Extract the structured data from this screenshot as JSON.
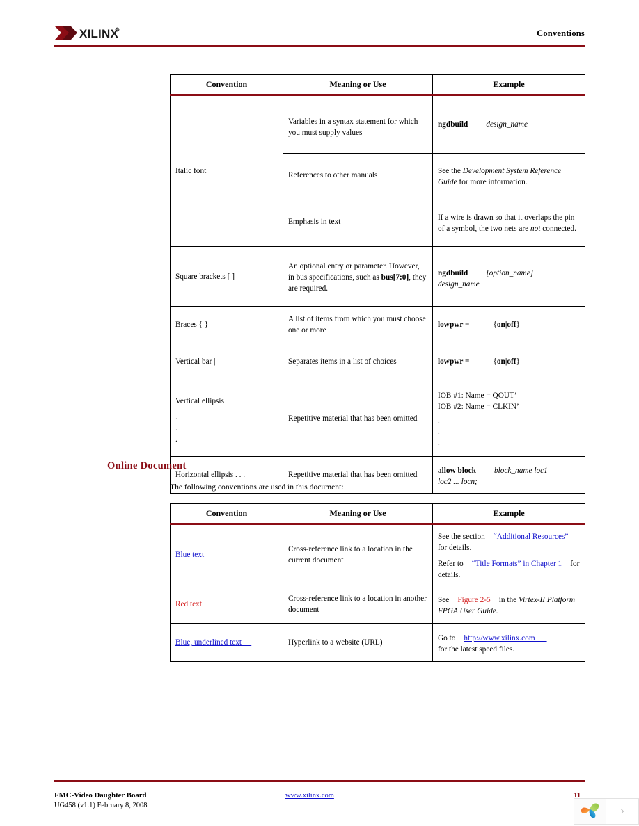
{
  "header": {
    "logo_name": "xilinx-logo",
    "logo_text": "XILINX",
    "title": "Conventions",
    "rule_color": "#8B0D15"
  },
  "table1": {
    "name": "typographical-conventions-table",
    "columns": [
      "Convention",
      "Meaning or Use",
      "Example"
    ],
    "rows": [
      {
        "convention": "Italic font",
        "sub": [
          {
            "meaning": "Variables in a syntax statement for which you must supply values",
            "example_bold": "ngdbuild",
            "example_italic": "design_name"
          },
          {
            "meaning": "References to other manuals",
            "example": "See the Development System Reference Guide for more information."
          },
          {
            "meaning": "Emphasis in text",
            "example": "If a wire is drawn so that it overlaps the pin of a symbol, the two nets are not connected."
          }
        ]
      },
      {
        "convention": "Square brackets   [ ]",
        "meaning": "An optional entry or parameter. However, in bus specifications, such as bus[7:0], they are required.",
        "example_bold": "ngdbuild",
        "example_italic1": "[option_name]",
        "example_italic2": "design_name"
      },
      {
        "convention": "Braces   { }",
        "meaning": "A list of items from which you must choose one or more",
        "example_bold": "lowpwr =",
        "example_braces": "{on|off}"
      },
      {
        "convention": "Vertical bar   |",
        "meaning": "Separates items in a list of choices",
        "example_bold": "lowpwr =",
        "example_braces": "{on|off}"
      },
      {
        "convention": "Vertical ellipsis",
        "convention_dots": [
          ".",
          ".",
          "."
        ],
        "meaning": "Repetitive material that has been omitted",
        "example_line1": "IOB #1: Name = QOUT’",
        "example_line2": "IOB #2: Name = CLKIN’",
        "example_dots": [
          ".",
          ".",
          "."
        ]
      },
      {
        "convention": "Horizontal ellipsis  . . .",
        "meaning": "Repetitive material that has been omitted",
        "example_bold": "allow block",
        "example_italic1": "block_name loc1",
        "example_italic2": "loc2 ... locn;"
      }
    ]
  },
  "section": {
    "heading": "Online Document",
    "intro": "The following conventions are used in this document:"
  },
  "table2": {
    "name": "online-document-conventions-table",
    "columns": [
      "Convention",
      "Meaning or Use",
      "Example"
    ],
    "rows": [
      {
        "convention": "Blue text",
        "convention_style": "blue",
        "meaning": "Cross-reference link to a location in the current document",
        "example_p1_pre": "See the section",
        "example_p1_link": "“Additional Resources”",
        "example_p1_post": "for details.",
        "example_p2_pre": "Refer to",
        "example_p2_link": "“Title Formats” in Chapter 1",
        "example_p2_post": "for details."
      },
      {
        "convention": "Red text",
        "convention_style": "red",
        "meaning": "Cross-reference link to a location in another document",
        "example_pre": "See",
        "example_link": "Figure 2-5",
        "example_mid": "in the",
        "example_italic": "Virtex-II Platform FPGA User Guide."
      },
      {
        "convention": "Blue, underlined text",
        "convention_style": "bluelink",
        "meaning": "Hyperlink to a website (URL)",
        "example_pre": "Go to",
        "example_link": "http://www.xilinx.com",
        "example_post": "for the latest speed files."
      }
    ]
  },
  "footer": {
    "doc_title": "FMC-Video  Daughter Board",
    "doc_id": "UG458 (v1.1) February 8, 2008",
    "url": "www.xilinx.com",
    "page_number": "11"
  },
  "widget": {
    "logo_icon": "colored-leaves-logo-icon",
    "next_icon": "chevron-right-icon"
  },
  "colors": {
    "maroon": "#8B0D15",
    "blue": "#1111CC",
    "red": "#D42020"
  }
}
